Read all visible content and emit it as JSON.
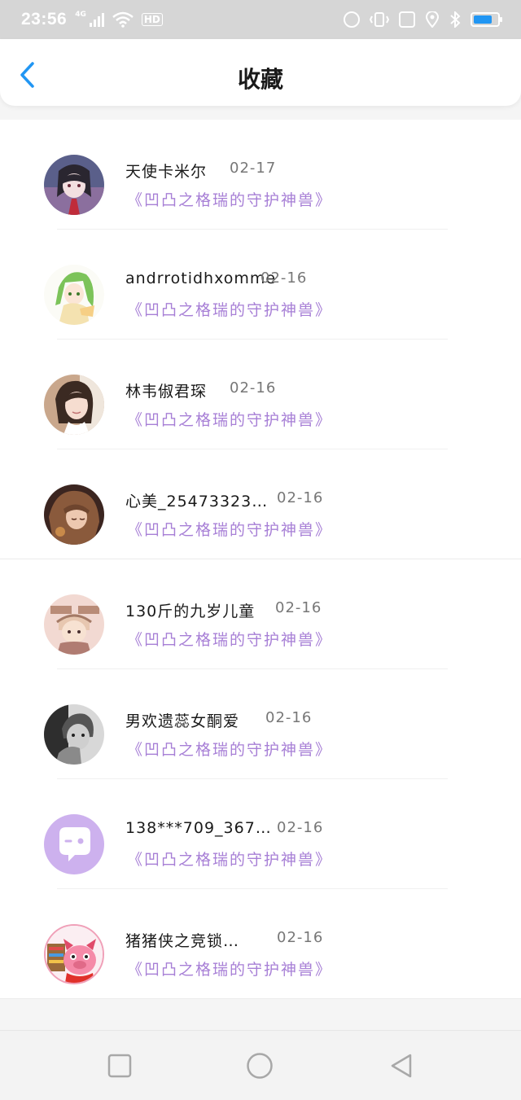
{
  "status_bar": {
    "time": "23:56",
    "network_tag": "4G",
    "hd_label": "HD"
  },
  "header": {
    "title": "收藏"
  },
  "favorites": [
    {
      "username": "天使卡米尔",
      "date": "02-17",
      "title": "《凹凸之格瑞的守护神兽》",
      "avatar_icon": "anime-girl-dark-hair-avatar"
    },
    {
      "username": "andrrotidhxomme",
      "date": "02-16",
      "title": "《凹凸之格瑞的守护神兽》",
      "avatar_icon": "anime-green-hair-avatar"
    },
    {
      "username": "林韦俶君琛",
      "date": "02-16",
      "title": "《凹凸之格瑞的守护神兽》",
      "avatar_icon": "photo-girl-avatar"
    },
    {
      "username": "心美_25473323…",
      "date": "02-16",
      "title": "《凹凸之格瑞的守护神兽》",
      "avatar_icon": "illustrated-girl-avatar"
    },
    {
      "username": "130斤的九岁儿童",
      "date": "02-16",
      "title": "《凹凸之格瑞的守护神兽》",
      "avatar_icon": "cartoon-boy-avatar"
    },
    {
      "username": "男欢遗蕊女酮爱",
      "date": "02-16",
      "title": "《凹凸之格瑞的守护神兽》",
      "avatar_icon": "bw-photo-child-avatar"
    },
    {
      "username": "138***709_367…",
      "date": "02-16",
      "title": "《凹凸之格瑞的守护神兽》",
      "avatar_icon": "default-chat-avatar"
    },
    {
      "username": "猪猪侠之竞锁…",
      "date": "02-16",
      "title": "《凹凸之格瑞的守护神兽》",
      "avatar_icon": "cartoon-pig-avatar"
    }
  ],
  "colors": {
    "accent_blue": "#2196f3",
    "title_purple": "#a77fd6"
  },
  "nav": {
    "recent_icon": "square-icon",
    "home_icon": "circle-icon",
    "back_icon": "triangle-back-icon"
  }
}
